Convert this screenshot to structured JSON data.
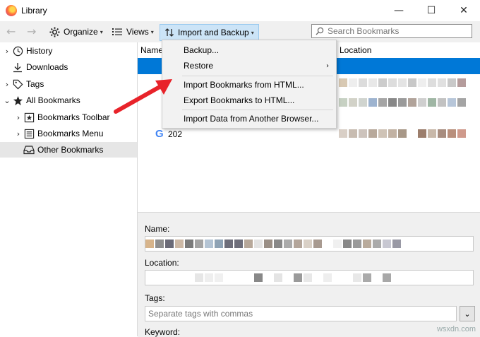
{
  "window": {
    "title": "Library",
    "minimize": "—",
    "maximize": "☐",
    "close": "✕"
  },
  "toolbar": {
    "back": "←",
    "forward": "→",
    "organize": "Organize",
    "views": "Views",
    "import_backup": "Import and Backup",
    "search_placeholder": "Search Bookmarks"
  },
  "sidebar": {
    "items": [
      {
        "label": "History",
        "icon": "clock-icon",
        "twisty": "›"
      },
      {
        "label": "Downloads",
        "icon": "download-icon",
        "twisty": ""
      },
      {
        "label": "Tags",
        "icon": "tag-icon",
        "twisty": "›"
      },
      {
        "label": "All Bookmarks",
        "icon": "star-icon",
        "twisty": "⌄"
      },
      {
        "label": "Bookmarks Toolbar",
        "icon": "toolbar-star-icon",
        "twisty": "›"
      },
      {
        "label": "Bookmarks Menu",
        "icon": "menu-list-icon",
        "twisty": "›"
      },
      {
        "label": "Other Bookmarks",
        "icon": "tray-icon",
        "twisty": ""
      }
    ]
  },
  "list": {
    "col_name": "Name",
    "col_location": "Location",
    "visible_row_text": "202",
    "row_icon_g": "G"
  },
  "menu": {
    "items": [
      {
        "label": "Backup...",
        "submenu": false
      },
      {
        "label": "Restore",
        "submenu": true
      },
      {
        "label": "Import Bookmarks from HTML...",
        "submenu": false
      },
      {
        "label": "Export Bookmarks to HTML...",
        "submenu": false
      },
      {
        "label": "Import Data from Another Browser...",
        "submenu": false
      }
    ],
    "submenu_arrow": "›"
  },
  "details": {
    "name_label": "Name:",
    "location_label": "Location:",
    "tags_label": "Tags:",
    "tags_placeholder": "Separate tags with commas",
    "keyword_label": "Keyword:",
    "dropdown_arrow": "⌄"
  },
  "colors": {
    "selection": "#0078d7",
    "menu_bg": "#f2f2f2",
    "accent_arrow": "#e8232a"
  },
  "watermark": "wsxdn.com"
}
